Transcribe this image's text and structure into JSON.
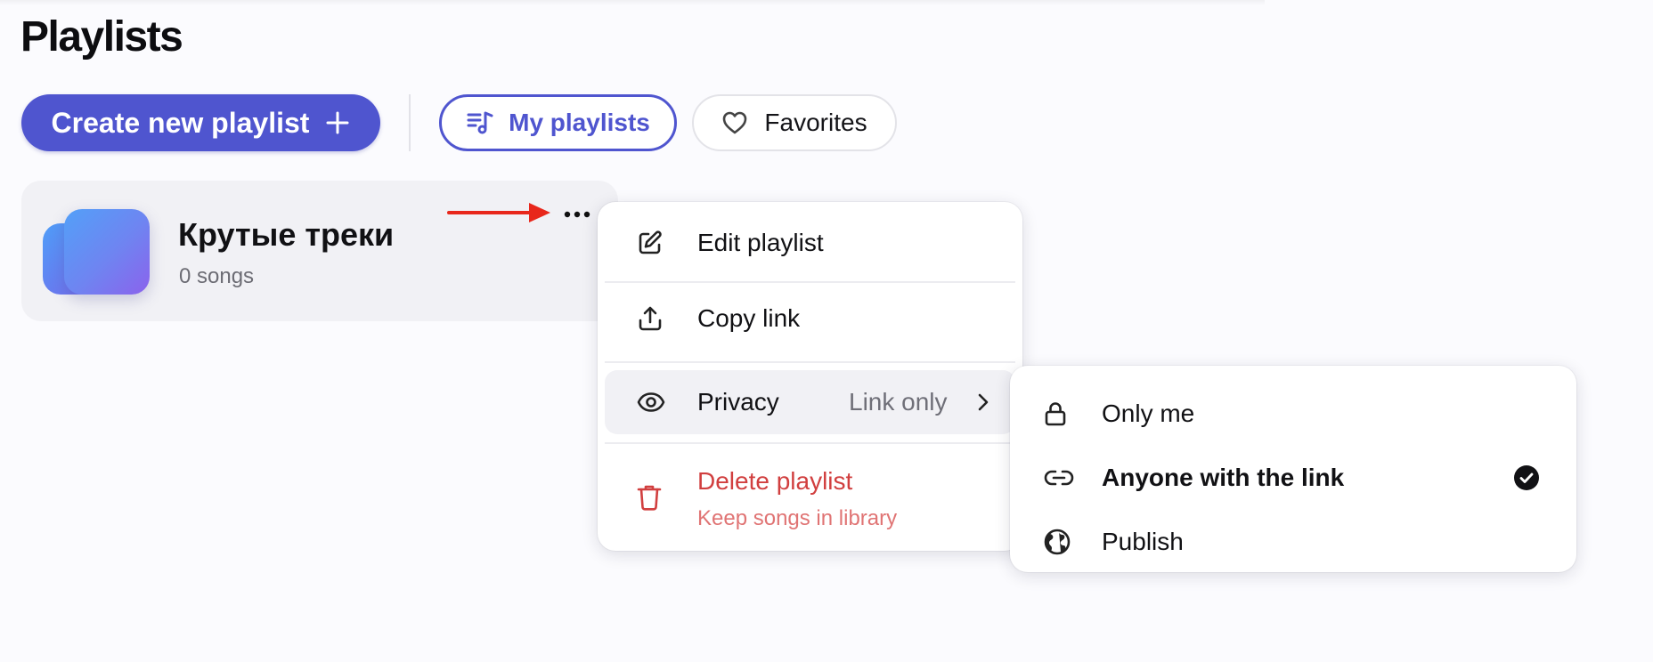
{
  "page": {
    "title": "Playlists"
  },
  "toolbar": {
    "create_label": "Create new playlist",
    "tabs": [
      {
        "label": "My playlists",
        "icon": "music-list-icon",
        "active": true
      },
      {
        "label": "Favorites",
        "icon": "heart-icon",
        "active": false
      }
    ]
  },
  "playlist": {
    "title": "Крутые треки",
    "subtitle": "0 songs"
  },
  "menu": {
    "items": [
      {
        "label": "Edit playlist",
        "icon": "edit-icon"
      },
      {
        "label": "Copy link",
        "icon": "share-icon"
      },
      {
        "label": "Privacy",
        "value": "Link only",
        "icon": "eye-icon"
      },
      {
        "label": "Delete playlist",
        "sublabel": "Keep songs in library",
        "icon": "trash-icon"
      }
    ]
  },
  "privacy_menu": {
    "options": [
      {
        "label": "Only me",
        "icon": "lock-icon",
        "selected": false
      },
      {
        "label": "Anyone with the link",
        "icon": "link-icon",
        "selected": true
      },
      {
        "label": "Publish",
        "icon": "globe-icon",
        "selected": false
      }
    ]
  },
  "colors": {
    "accent": "#4f55cf",
    "danger": "#d13f3f",
    "annotation_arrow": "#e8271b",
    "card_bg": "#f1f1f5"
  }
}
